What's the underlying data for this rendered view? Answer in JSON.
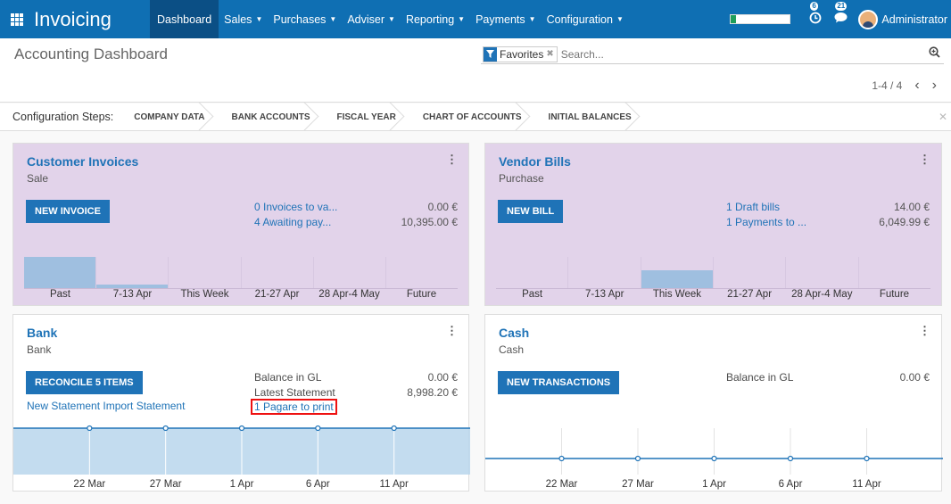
{
  "app": {
    "title": "Invoicing",
    "user": "Administrator",
    "progress": 0.08,
    "activity_count": "6",
    "message_count": "21"
  },
  "menu": [
    {
      "label": "Dashboard",
      "caret": false,
      "active": true
    },
    {
      "label": "Sales",
      "caret": true
    },
    {
      "label": "Purchases",
      "caret": true
    },
    {
      "label": "Adviser",
      "caret": true
    },
    {
      "label": "Reporting",
      "caret": true
    },
    {
      "label": "Payments",
      "caret": true
    },
    {
      "label": "Configuration",
      "caret": true
    }
  ],
  "control": {
    "breadcrumb": "Accounting Dashboard",
    "facet": "Favorites",
    "search_placeholder": "Search...",
    "pager": "1-4 / 4"
  },
  "steps": {
    "label": "Configuration Steps:",
    "items": [
      "COMPANY DATA",
      "BANK ACCOUNTS",
      "FISCAL YEAR",
      "CHART OF ACCOUNTS",
      "INITIAL BALANCES"
    ]
  },
  "cards": {
    "customer": {
      "title": "Customer Invoices",
      "subtitle": "Sale",
      "button": "NEW INVOICE",
      "rows": [
        {
          "label": "0 Invoices to va...",
          "value": "0.00 €"
        },
        {
          "label": "4 Awaiting pay...",
          "value": "10,395.00 €"
        }
      ]
    },
    "vendor": {
      "title": "Vendor Bills",
      "subtitle": "Purchase",
      "button": "NEW BILL",
      "rows": [
        {
          "label": "1 Draft bills",
          "value": "14.00 €"
        },
        {
          "label": "1 Payments to ...",
          "value": "6,049.99 €"
        }
      ]
    },
    "bank": {
      "title": "Bank",
      "subtitle": "Bank",
      "button": "RECONCILE 5 ITEMS",
      "import_link": "New Statement Import Statement",
      "balance_label": "Balance in GL",
      "balance_value": "0.00 €",
      "statement_label": "Latest Statement",
      "statement_value": "8,998.20 €",
      "print_link": "1 Pagare to print"
    },
    "cash": {
      "title": "Cash",
      "subtitle": "Cash",
      "button": "NEW TRANSACTIONS",
      "balance_label": "Balance in GL",
      "balance_value": "0.00 €"
    }
  },
  "colors": {
    "brand": "#0f6fb3",
    "purple_card": "#e2d3ea",
    "bar": "#9fbfe0",
    "area_fill": "#b8d6ec",
    "highlight": "#e11111"
  },
  "chart_data": [
    {
      "type": "bar",
      "categories": [
        "Past",
        "7-13 Apr",
        "This Week",
        "21-27 Apr",
        "28 Apr-4 May",
        "Future"
      ],
      "values": [
        10395,
        1200,
        0,
        0,
        0,
        0
      ]
    },
    {
      "type": "bar",
      "categories": [
        "Past",
        "7-13 Apr",
        "This Week",
        "21-27 Apr",
        "28 Apr-4 May",
        "Future"
      ],
      "values": [
        0,
        0,
        6049.99,
        0,
        0,
        0
      ]
    },
    {
      "type": "area",
      "categories": [
        "22 Mar",
        "27 Mar",
        "1 Apr",
        "6 Apr",
        "11 Apr"
      ],
      "values": [
        8998.2,
        8998.2,
        8998.2,
        8998.2,
        8998.2,
        8998.2,
        8998.2
      ]
    },
    {
      "type": "line",
      "categories": [
        "22 Mar",
        "27 Mar",
        "1 Apr",
        "6 Apr",
        "11 Apr"
      ],
      "values": [
        0,
        0,
        0,
        0,
        0,
        0,
        0
      ]
    }
  ]
}
